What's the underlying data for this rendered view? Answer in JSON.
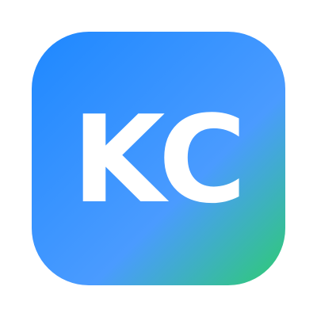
{
  "icon": {
    "initials": "KC",
    "colors": {
      "gradient_start": "#1E88FF",
      "gradient_mid": "#4A9BFF",
      "gradient_end": "#2ECC71",
      "text": "#FFFFFF"
    }
  }
}
